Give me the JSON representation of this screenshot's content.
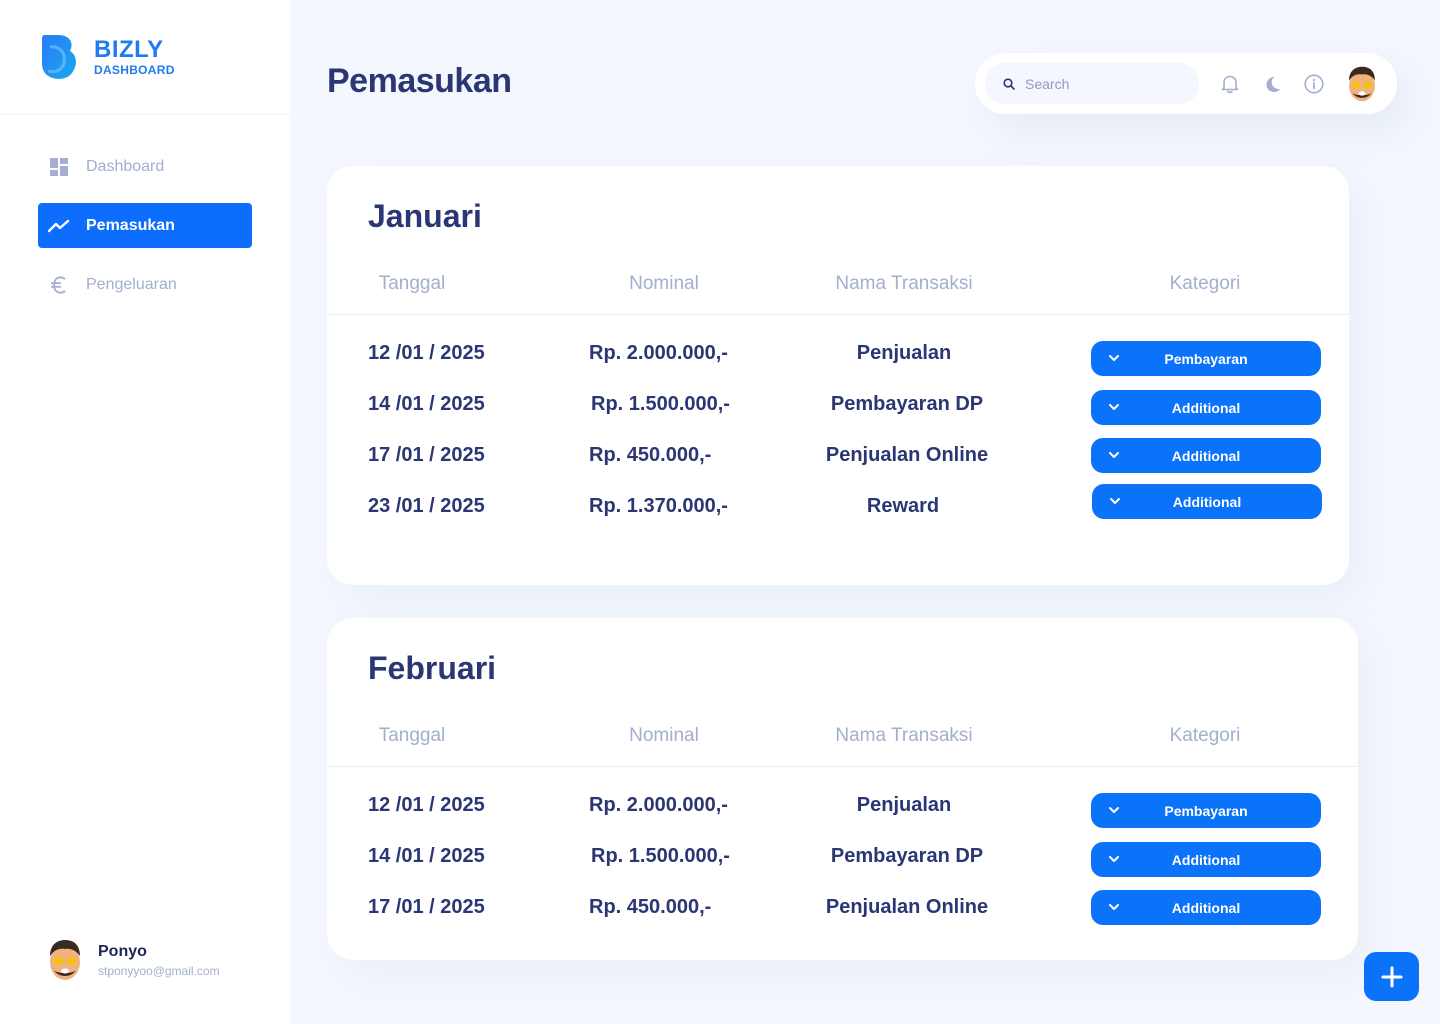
{
  "brand": {
    "name": "BIZLY",
    "subtitle": "DASHBOARD"
  },
  "sidebar": {
    "items": [
      {
        "label": "Dashboard",
        "icon": "dashboard-grid-icon",
        "active": false
      },
      {
        "label": "Pemasukan",
        "icon": "trending-up-icon",
        "active": true
      },
      {
        "label": "Pengeluaran",
        "icon": "euro-icon",
        "active": false
      }
    ],
    "user": {
      "name": "Ponyo",
      "email": "stponyyoo@gmail.com"
    }
  },
  "header": {
    "title": "Pemasukan",
    "search_placeholder": "Search",
    "icons": [
      "bell-icon",
      "moon-icon",
      "info-icon"
    ]
  },
  "table_headers": {
    "date": "Tanggal",
    "amount": "Nominal",
    "name": "Nama Transaksi",
    "category": "Kategori"
  },
  "months": [
    {
      "title": "Januari",
      "rows": [
        {
          "date": "12 /01 / 2025",
          "amount": "Rp. 2.000.000,-",
          "name": "Penjualan",
          "category": "Pembayaran"
        },
        {
          "date": "14 /01 / 2025",
          "amount": "Rp. 1.500.000,-",
          "name": "Pembayaran DP",
          "category": "Additional"
        },
        {
          "date": "17 /01 / 2025",
          "amount": "Rp. 450.000,-",
          "name": "Penjualan Online",
          "category": "Additional"
        },
        {
          "date": "23 /01 / 2025",
          "amount": "Rp. 1.370.000,-",
          "name": "Reward",
          "category": "Additional"
        }
      ]
    },
    {
      "title": "Februari",
      "rows": [
        {
          "date": "12 /01 / 2025",
          "amount": "Rp. 2.000.000,-",
          "name": "Penjualan",
          "category": "Pembayaran"
        },
        {
          "date": "14 /01 / 2025",
          "amount": "Rp. 1.500.000,-",
          "name": "Pembayaran DP",
          "category": "Additional"
        },
        {
          "date": "17 /01 / 2025",
          "amount": "Rp. 450.000,-",
          "name": "Penjualan Online",
          "category": "Additional"
        }
      ]
    }
  ],
  "colors": {
    "accent": "#0b73fa",
    "text": "#2b3674",
    "muted": "#a3aed0",
    "background": "#f4f7fe"
  }
}
